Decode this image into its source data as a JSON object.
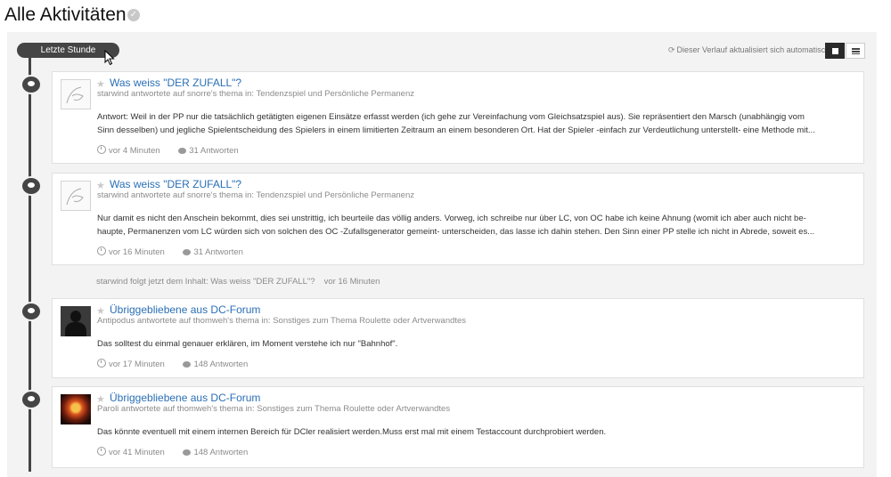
{
  "page": {
    "title": "Alle Aktivitäten"
  },
  "timeline": {
    "period_label": "Letzte Stunde"
  },
  "toolbar": {
    "auto_update_text": "Dieser Verlauf aktualisiert sich automatisch"
  },
  "items": [
    {
      "title": "Was weiss \"DER ZUFALL\"?",
      "meta": "starwind antwortete auf snorre's thema in: Tendenzspiel und Persönliche Permanenz",
      "body": [
        "Antwort: Weil in der PP nur die tatsächlich getätigten eigenen Einsätze erfasst werden (ich gehe zur Vereinfachung vom Gleichsatzspiel aus). Sie repräsentiert den Marsch (unabhängig vom",
        "Sinn desselben) und jegliche Spielentscheidung des Spielers in einem limitierten Zeitraum an einem besonderen Ort. Hat der Spieler -einfach zur Verdeutlichung unterstellt- eine Methode mit..."
      ],
      "time": "vor 4 Minuten",
      "replies": "31 Antworten"
    },
    {
      "title": "Was weiss \"DER ZUFALL\"?",
      "meta": "starwind antwortete auf snorre's thema in: Tendenzspiel und Persönliche Permanenz",
      "body": [
        "Nur damit es nicht den Anschein bekommt, dies sei unstrittig, ich beurteile das völlig anders. Vorweg, ich schreibe nur über LC, von OC habe ich keine Ahnung (womit ich aber auch nicht be-",
        "haupte, Permanenzen vom LC würden sich von solchen des OC -Zufallsgenerator gemeint- unterscheiden, das lasse ich dahin stehen. Den Sinn einer PP stelle ich nicht in Abrede, soweit es..."
      ],
      "time": "vor 16 Minuten",
      "replies": "31 Antworten"
    },
    {
      "title": "Übriggebliebene aus DC-Forum",
      "meta": "Antipodus antwortete auf thomweh's thema in: Sonstiges zum Thema Roulette oder Artverwandtes",
      "body": [
        "Das solltest du einmal genauer erklären, im Moment verstehe ich nur \"Bahnhof\"."
      ],
      "time": "vor 17 Minuten",
      "replies": "148 Antworten"
    },
    {
      "title": "Übriggebliebene aus DC-Forum",
      "meta": "Paroli antwortete auf thomweh's thema in: Sonstiges zum Thema Roulette oder Artverwandtes",
      "body": [
        "Das könnte eventuell mit einem internen Bereich für DCler realisiert werden.Muss erst mal mit einem Testaccount durchprobiert werden."
      ],
      "time": "vor 41 Minuten",
      "replies": "148 Antworten"
    }
  ],
  "follow": {
    "text": "starwind folgt jetzt dem Inhalt: Was weiss \"DER ZUFALL\"?",
    "time": "vor 16 Minuten"
  }
}
